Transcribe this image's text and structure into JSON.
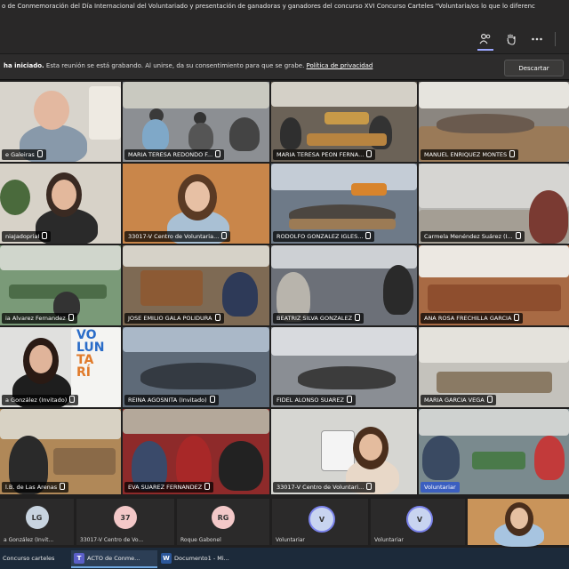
{
  "window": {
    "title": "o de Conmemoración del Día Internacional del Voluntariado y presentación de ganadoras y ganadores del concurso XVI Concurso Carteles \"Voluntaria/os lo que lo diferenc"
  },
  "toolbar": {
    "participants_icon": "people-icon",
    "raise_hand_icon": "hand-icon",
    "more_icon": "more-icon"
  },
  "recording": {
    "bold": "ha iniciado.",
    "message": " Esta reunión se está grabando. Al unirse, da su consentimiento para que se grabe. ",
    "link": "Política de privacidad",
    "dismiss": "Descartar"
  },
  "tiles": [
    {
      "name": "e Galeiras"
    },
    {
      "name": "MARIA TERESA REDONDO F..."
    },
    {
      "name": "MARIA TERESA PEON FERNA..."
    },
    {
      "name": "MANUEL ENRIQUEZ MONTES"
    },
    {
      "name": "niaJadopriaI"
    },
    {
      "name": "33017-V Centro de Voluntaria..."
    },
    {
      "name": "RODOLFO GONZALEZ IGLES..."
    },
    {
      "name": "Carmela Menéndez Suárez (I..."
    },
    {
      "name": "ia Alvarez Fernandez"
    },
    {
      "name": "JOSE EMILIO GALA POLIDURA"
    },
    {
      "name": "BEATRIZ SILVA GONZALEZ"
    },
    {
      "name": "ANA ROSA FRECHILLA GARCIA"
    },
    {
      "name": "a González (Invitado)"
    },
    {
      "name": "REINA AGOSNITA (Invitado)"
    },
    {
      "name": "FIDEL ALONSO SUAREZ"
    },
    {
      "name": "MARIA GARCIA VEGA"
    },
    {
      "name": "l.B. de Las Arenas"
    },
    {
      "name": "EVA SUAREZ FERNANDEZ"
    },
    {
      "name": "33017-V Centro de Voluntari..."
    },
    {
      "name": "Voluntariar"
    }
  ],
  "poster": {
    "line1": "VO",
    "line2": "LUN",
    "line3": "TA",
    "line4": "RÍ"
  },
  "bottom_participants": [
    {
      "initials": "LG",
      "name": "a González (Invit...",
      "color": "#c8d4e0"
    },
    {
      "initials": "37",
      "name": "33017-V Centro de Vo...",
      "color": "#f3c8c8"
    },
    {
      "initials": "RG",
      "name": "Roque Gabonel",
      "color": "#f3c8c8"
    },
    {
      "initials": "V",
      "name": "Voluntariar",
      "color": "#c8d4f0"
    },
    {
      "initials": "V",
      "name": "Voluntariar",
      "color": "#c8d4f0"
    }
  ],
  "taskbar": [
    {
      "label": "Concurso carteles",
      "icon": ""
    },
    {
      "label": "ACTO de Conme...",
      "icon": "T"
    },
    {
      "label": "Documento1 - Mi...",
      "icon": "W"
    }
  ]
}
